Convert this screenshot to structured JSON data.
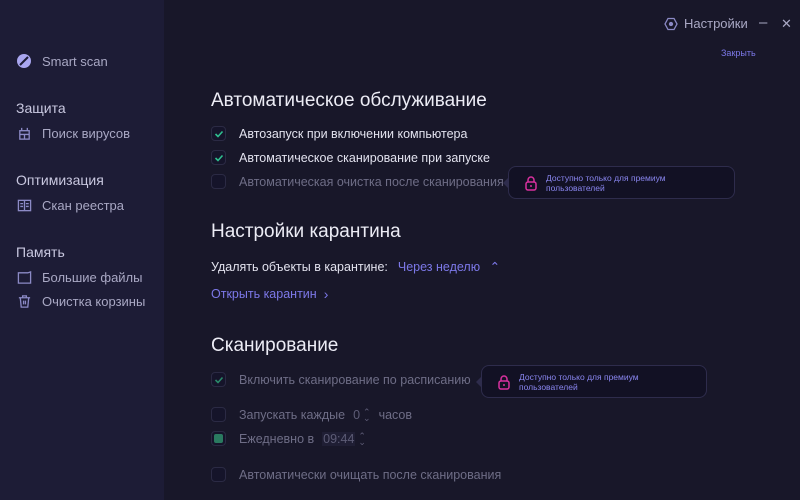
{
  "sidebar": {
    "smart_scan": "Smart scan",
    "sections": [
      {
        "title": "Защита",
        "items": [
          "Поиск вирусов"
        ]
      },
      {
        "title": "Оптимизация",
        "items": [
          "Скан реестра"
        ]
      },
      {
        "title": "Память",
        "items": [
          "Большие файлы",
          "Очистка корзины"
        ]
      }
    ]
  },
  "header": {
    "settings": "Настройки",
    "minimize": "–",
    "close": "✕",
    "close_link": "Закрыть"
  },
  "auto": {
    "title": "Автоматическое обслуживание",
    "items": [
      {
        "label": "Автозапуск при включении компьютера",
        "checked": true
      },
      {
        "label": "Автоматическое сканирование при запуске",
        "checked": true
      },
      {
        "label": "Автоматическая очистка после сканирования",
        "checked": false
      }
    ]
  },
  "premium_tip": "Доступно только для премиум пользователей",
  "quarantine": {
    "title": "Настройки карантина",
    "delete_label": "Удалять объекты в карантине:",
    "delete_value": "Через неделю",
    "open": "Открыть карантин"
  },
  "scan": {
    "title": "Сканирование",
    "schedule": "Включить сканирование по расписанию",
    "every_label": "Запускать каждые",
    "every_value": "0",
    "every_unit": "часов",
    "daily_label": "Ежедневно в",
    "daily_value": "09:44",
    "auto_clean": "Автоматически очищать после сканирования"
  },
  "colors": {
    "accent": "#7c78e8",
    "check": "#2fbf8f",
    "lock": "#e0309a"
  }
}
